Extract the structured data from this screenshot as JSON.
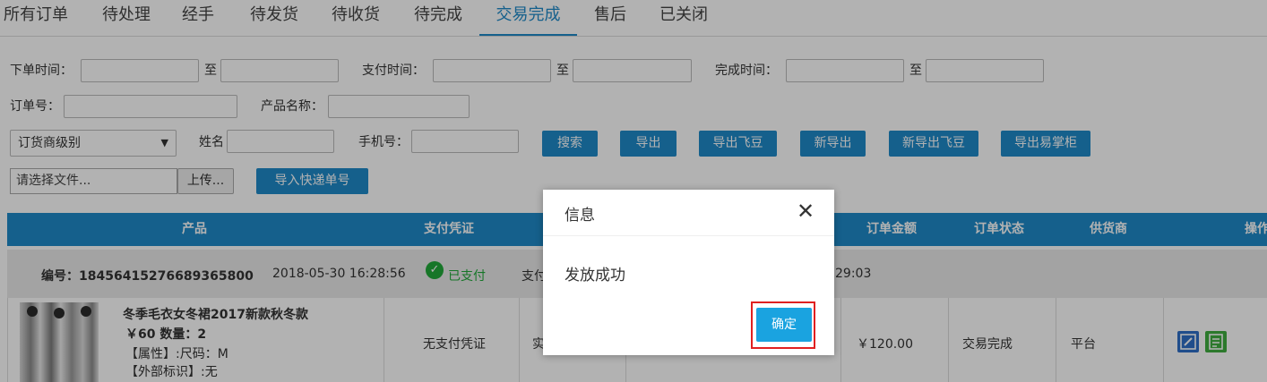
{
  "tabs": [
    "所有订单",
    "待处理",
    "经手",
    "待发货",
    "待收货",
    "待完成",
    "交易完成",
    "售后",
    "已关闭"
  ],
  "active_tab": "交易完成",
  "filters": {
    "order_time_label": "下单时间：",
    "pay_time_label": "支付时间：",
    "complete_time_label": "完成时间：",
    "to_label": "至",
    "order_no_label": "订单号：",
    "product_name_label": "产品名称：",
    "supplier_level_select": "订货商级别",
    "name_label": "姓名",
    "phone_label": "手机号："
  },
  "buttons": {
    "search": "搜索",
    "export": "导出",
    "export_feidou": "导出飞豆",
    "new_export": "新导出",
    "new_export_feidou": "新导出飞豆",
    "export_yizhanggui": "导出易掌柜",
    "import_express": "导入快递单号"
  },
  "upload": {
    "file_placeholder": "请选择文件...",
    "upload_button": "上传..."
  },
  "table": {
    "headers": {
      "product": "产品",
      "payment_proof": "支付凭证",
      "order_amount": "订单金额",
      "order_status": "订单状态",
      "supplier": "供货商",
      "actions": "操作"
    },
    "order": {
      "number": "编号：18456415276689365800",
      "created_at": "2018-05-30 16:28:56",
      "paid_status": "已支付",
      "pay_prefix": "支付",
      "time_tail": "29:03"
    },
    "item": {
      "title": "冬季毛衣女冬裙2017新款秋冬款",
      "price_qty": "￥60 数量：2",
      "attributes": "【属性】:尺码：M",
      "external_tag": "【外部标识】:无",
      "payment_proof": "无支付凭证",
      "partial_text": "实",
      "amount": "￥120.00",
      "status": "交易完成",
      "supplier": "平台"
    }
  },
  "dialog": {
    "title": "信息",
    "message": "发放成功",
    "ok_button": "确定"
  },
  "colors": {
    "primary": "#1f8ac9",
    "paid_green": "#22a93a",
    "highlight_red": "#e02020",
    "dialog_button": "#1aa3e0"
  }
}
